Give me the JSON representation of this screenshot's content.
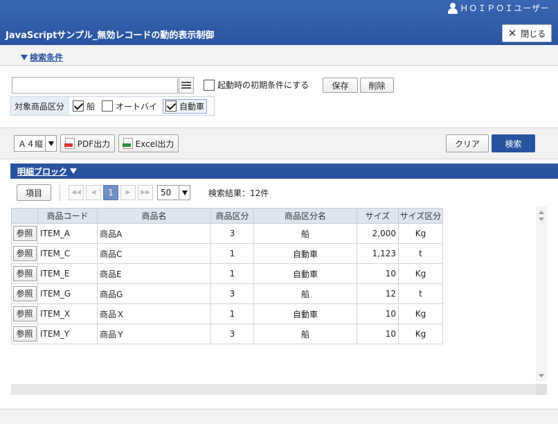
{
  "header": {
    "user_name": "ＨＯＩＰＯＩユーザー",
    "title": "JavaScriptサンプル_無効レコードの動的表示制御",
    "close_label": "閉じる",
    "colors": {
      "header_bg": "#2a539f",
      "accent": "#2a539f"
    }
  },
  "conditions": {
    "toggle_label": "検索条件",
    "search_value": "",
    "init_condition_label": "起動時の初期条件にする",
    "init_condition_checked": false,
    "save_label": "保存",
    "delete_label": "削除",
    "category_label": "対象商品区分",
    "category_options": [
      {
        "label": "船",
        "checked": true
      },
      {
        "label": "オートバイ",
        "checked": false
      },
      {
        "label": "自動車",
        "checked": true
      }
    ]
  },
  "toolbar": {
    "paper_size": "Ａ４縦",
    "pdf_label": "PDF出力",
    "excel_label": "Excel出力",
    "clear_label": "クリア",
    "search_label": "検索"
  },
  "detail": {
    "block_title": "明細ブロック",
    "columns_button": "項目",
    "current_page": "1",
    "per_page": "50",
    "result_count": "検索結果：12件",
    "ref_label": "参照",
    "columns": [
      "商品コード",
      "商品名",
      "商品区分",
      "商品区分名",
      "サイズ",
      "サイズ区分"
    ],
    "rows": [
      {
        "code": "ITEM_A",
        "name": "商品A",
        "cat": "3",
        "cat_name": "船",
        "size": "2,000",
        "size_unit": "Kg"
      },
      {
        "code": "ITEM_C",
        "name": "商品C",
        "cat": "1",
        "cat_name": "自動車",
        "size": "1,123",
        "size_unit": "t"
      },
      {
        "code": "ITEM_E",
        "name": "商品E",
        "cat": "1",
        "cat_name": "自動車",
        "size": "10",
        "size_unit": "Kg"
      },
      {
        "code": "ITEM_G",
        "name": "商品G",
        "cat": "3",
        "cat_name": "船",
        "size": "12",
        "size_unit": "t"
      },
      {
        "code": "ITEM_X",
        "name": "商品Ｘ",
        "cat": "1",
        "cat_name": "自動車",
        "size": "10",
        "size_unit": "Kg"
      },
      {
        "code": "ITEM_Y",
        "name": "商品Ｙ",
        "cat": "3",
        "cat_name": "船",
        "size": "10",
        "size_unit": "Kg"
      }
    ]
  }
}
